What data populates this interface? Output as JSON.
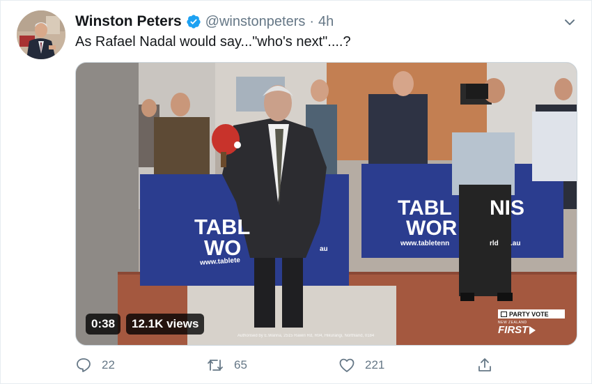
{
  "tweet": {
    "display_name": "Winston Peters",
    "handle": "@winstonpeters",
    "separator": "·",
    "time": "4h",
    "text": "As Rafael Nadal would say...\"who's next\"....?",
    "verified": true
  },
  "media": {
    "duration": "0:38",
    "views": "12.1K views",
    "banner_left_line1": "TABL",
    "banner_left_line2": "WO",
    "banner_left_url": "www.tablete",
    "banner_left_url_tail": "au",
    "banner_right_line1": "TABL",
    "banner_right_line1b": "NIS",
    "banner_right_line2": "WOR",
    "banner_right_url": "www.tabletenn",
    "banner_right_url_tail": "rld",
    "banner_right_url_end": ".au",
    "party_vote_label": "PARTY VOTE",
    "party_small": "NEW ZEALAND",
    "party_name": "FIRST",
    "authorisation": "Authorised by E.Wanna, 2515 Rawiri Rd, R04, Hikurangi, Northland, 0184"
  },
  "actions": {
    "reply_count": "22",
    "retweet_count": "65",
    "like_count": "221"
  },
  "icons": {
    "verified": "verified-badge-icon",
    "caret": "chevron-down-icon",
    "reply": "reply-icon",
    "retweet": "retweet-icon",
    "like": "heart-icon",
    "share": "share-icon"
  },
  "colors": {
    "text": "#14171a",
    "secondary": "#657786",
    "verified": "#1da1f2",
    "banner_blue": "#2b3d8f"
  }
}
